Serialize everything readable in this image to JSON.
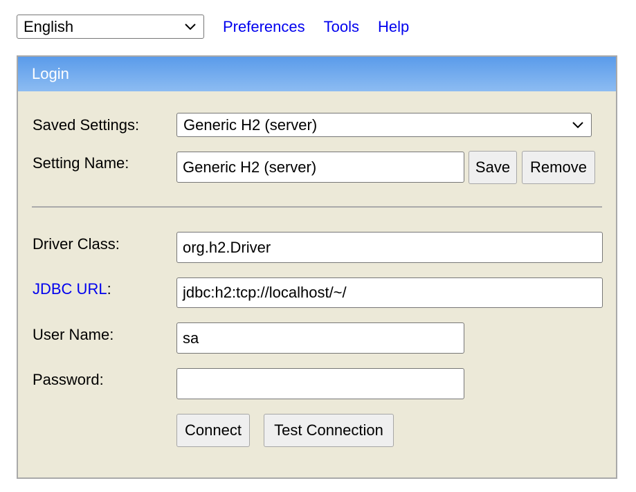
{
  "top_nav": {
    "language": "English",
    "links": [
      "Preferences",
      "Tools",
      "Help"
    ]
  },
  "login": {
    "title": "Login",
    "saved_settings": {
      "label": "Saved Settings:",
      "value": "Generic H2 (server)"
    },
    "setting_name": {
      "label": "Setting Name:",
      "value": "Generic H2 (server)"
    },
    "save_label": "Save",
    "remove_label": "Remove",
    "driver_class": {
      "label": "Driver Class:",
      "value": "org.h2.Driver"
    },
    "jdbc_url": {
      "label_link": "JDBC URL",
      "label_suffix": ":",
      "value": "jdbc:h2:tcp://localhost/~/"
    },
    "user_name": {
      "label": "User Name:",
      "value": "sa"
    },
    "password": {
      "label": "Password:",
      "value": ""
    },
    "connect_label": "Connect",
    "test_connection_label": "Test Connection"
  }
}
